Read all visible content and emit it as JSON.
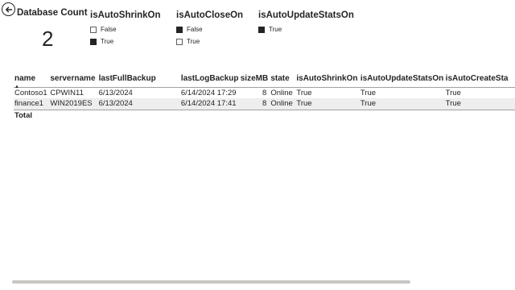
{
  "card": {
    "title": "Database Count",
    "value": "2"
  },
  "slicers": [
    {
      "title": "isAutoShrinkOn",
      "items": [
        {
          "label": "False",
          "checked": false
        },
        {
          "label": "True",
          "checked": true
        }
      ]
    },
    {
      "title": "isAutoCloseOn",
      "items": [
        {
          "label": "False",
          "checked": true
        },
        {
          "label": "True",
          "checked": false
        }
      ]
    },
    {
      "title": "isAutoUpdateStatsOn",
      "items": [
        {
          "label": "True",
          "checked": true
        }
      ]
    }
  ],
  "table": {
    "columns": [
      "name",
      "servername",
      "lastFullBackup",
      "lastLogBackup",
      "sizeMB",
      "state",
      "isAutoShrinkOn",
      "isAutoUpdateStatsOn",
      "isAutoCreateSta"
    ],
    "rows": [
      [
        "Contoso1",
        "CPWIN11",
        "6/13/2024",
        "6/14/2024 17:29",
        "8",
        "Online",
        "True",
        "True",
        "True"
      ],
      [
        "finance1",
        "WIN2019ES",
        "6/13/2024",
        "6/14/2024 17:41",
        "8",
        "Online",
        "True",
        "True",
        "True"
      ]
    ],
    "total_label": "Total",
    "sorted_column": "name",
    "sort_direction": "ascending"
  },
  "colors": {
    "text": "#252423",
    "row_alt": "#eeeeee",
    "scrollbar": "#c8c6c4"
  },
  "icons": {
    "back": "back-arrow-icon",
    "sort": "sort-ascending-icon"
  }
}
